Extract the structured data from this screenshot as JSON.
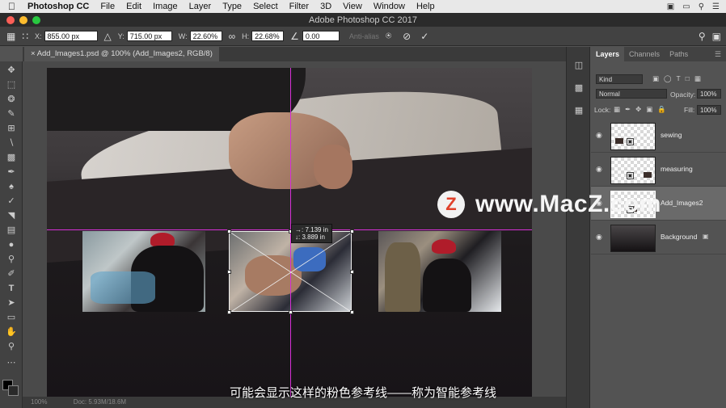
{
  "menubar": {
    "app": "Photoshop CC",
    "items": [
      "File",
      "Edit",
      "Image",
      "Layer",
      "Type",
      "Select",
      "Filter",
      "3D",
      "View",
      "Window",
      "Help"
    ]
  },
  "window": {
    "title": "Adobe Photoshop CC 2017"
  },
  "options": {
    "x_label": "X:",
    "x_value": "855.00 px",
    "y_label": "Y:",
    "y_value": "715.00 px",
    "w_label": "W:",
    "w_value": "22.60%",
    "h_label": "H:",
    "h_value": "22.68%",
    "angle_value": "0.00",
    "antialias_label": "Anti-alias"
  },
  "document": {
    "tab_title": "Add_Images1.psd @ 100% (Add_Images2, RGB/8)",
    "readout_line1": "→: 7.139 in",
    "readout_line2": "↓: 3.889 in"
  },
  "status": {
    "zoom": "100%",
    "doc": "Doc: 5.93M/18.6M"
  },
  "layers_panel": {
    "tabs": [
      "Layers",
      "Channels",
      "Paths"
    ],
    "kind_placeholder": "Kind",
    "blend_mode": "Normal",
    "opacity_label": "Opacity:",
    "opacity_value": "100%",
    "lock_label": "Lock:",
    "fill_label": "Fill:",
    "fill_value": "100%",
    "layers": [
      {
        "name": "sewing",
        "selected": false
      },
      {
        "name": "measuring",
        "selected": false
      },
      {
        "name": "Add_Images2",
        "selected": true
      },
      {
        "name": "Background",
        "selected": false
      }
    ]
  },
  "watermark": {
    "badge": "Z",
    "text": "www.MacZ.com"
  },
  "subtitle": "可能会显示这样的粉色参考线——称为智能参考线",
  "colors": {
    "guide": "#d630d6",
    "panel_bg": "#535353",
    "toolbar_bg": "#424242"
  }
}
